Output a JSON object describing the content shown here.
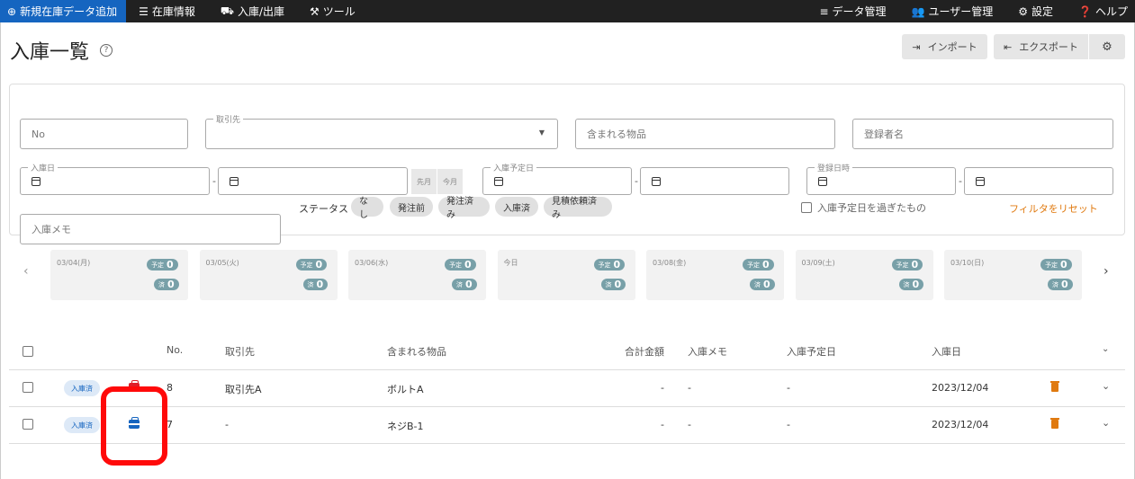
{
  "nav": {
    "add_new": "新規在庫データ追加",
    "stock_info": "在庫情報",
    "in_out": "入庫/出庫",
    "tools": "ツール",
    "data_mgmt": "データ管理",
    "user_mgmt": "ユーザー管理",
    "settings": "設定",
    "help": "ヘルプ"
  },
  "page_title": "入庫一覧",
  "buttons": {
    "import": "インポート",
    "export": "エクスポート"
  },
  "filters": {
    "no_placeholder": "No",
    "supplier_label": "取引先",
    "items_placeholder": "含まれる物品",
    "registrant_placeholder": "登録者名",
    "in_date_label": "入庫日",
    "prev_month": "先月",
    "this_month": "今月",
    "planned_date_label": "入庫予定日",
    "reg_datetime_label": "登録日時",
    "memo_placeholder": "入庫メモ",
    "status_label": "ステータス",
    "status_chips": [
      "なし",
      "発注前",
      "発注済み",
      "入庫済",
      "見積依頼済み"
    ],
    "overdue_label": "入庫予定日を過ぎたもの",
    "reset": "フィルタをリセット",
    "dash": "-"
  },
  "calendar": {
    "planned_label": "予定",
    "done_label": "済",
    "days": [
      {
        "date": "03/04(月)",
        "planned": "0",
        "done": "0"
      },
      {
        "date": "03/05(火)",
        "planned": "0",
        "done": "0"
      },
      {
        "date": "03/06(水)",
        "planned": "0",
        "done": "0"
      },
      {
        "date": "今日",
        "planned": "0",
        "done": "0"
      },
      {
        "date": "03/08(金)",
        "planned": "0",
        "done": "0"
      },
      {
        "date": "03/09(土)",
        "planned": "0",
        "done": "0"
      },
      {
        "date": "03/10(日)",
        "planned": "0",
        "done": "0"
      }
    ]
  },
  "table": {
    "headers": {
      "no": "No.",
      "supplier": "取引先",
      "items": "含まれる物品",
      "total": "合計金額",
      "memo": "入庫メモ",
      "planned": "入庫予定日",
      "in_date": "入庫日"
    },
    "rows": [
      {
        "status": "入庫済",
        "no": "8",
        "supplier": "取引先A",
        "items": "ボルトA",
        "total": "-",
        "memo": "-",
        "planned": "-",
        "in_date": "2023/12/04",
        "icon_color": "#e0202a"
      },
      {
        "status": "入庫済",
        "no": "7",
        "supplier": "-",
        "items": "ネジB-1",
        "total": "-",
        "memo": "-",
        "planned": "-",
        "in_date": "2023/12/04",
        "icon_color": "#1565c0"
      }
    ]
  },
  "colors": {
    "nav_bg": "#212121",
    "primary": "#1565c0",
    "highlight": "#ff0a0a",
    "accent_orange": "#e07a10"
  }
}
